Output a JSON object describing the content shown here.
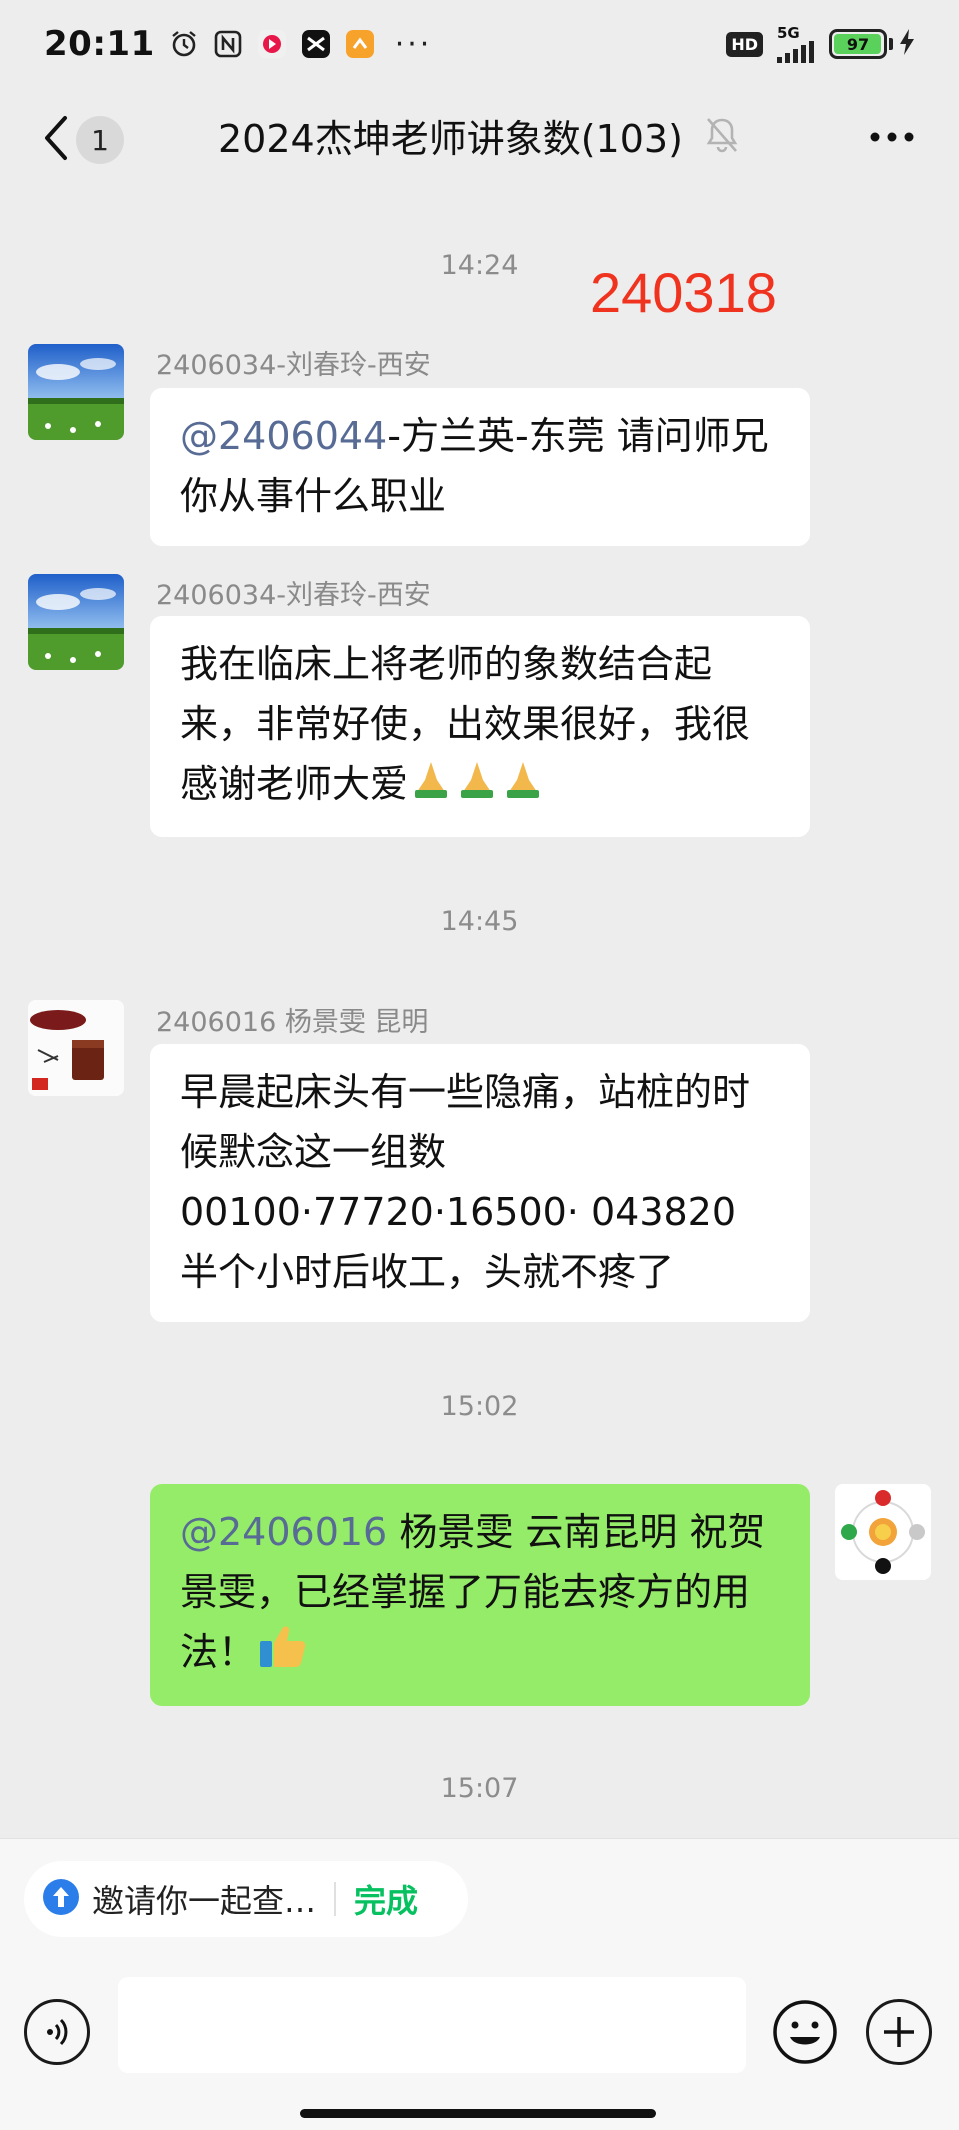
{
  "status_bar": {
    "time": "20:11",
    "network_badge": "HD",
    "network_type": "5G",
    "battery_level": "97",
    "battery_fraction": 0.97,
    "icons": [
      "alarm-icon",
      "nfc-icon",
      "music-app-icon",
      "capcut-icon",
      "orange-app-icon"
    ],
    "more": "···"
  },
  "header": {
    "unread_count": "1",
    "title": "2024杰坤老师讲象数(103)",
    "muted": true
  },
  "chat": {
    "stamp": "240318",
    "time_labels": [
      "14:24",
      "14:45",
      "15:02",
      "15:07"
    ],
    "messages": [
      {
        "sender": "2406034-刘春玲-西安",
        "mention": "@2406044",
        "text": "-方兰英-东莞  请问师兄你从事什么职业"
      },
      {
        "sender": "2406034-刘春玲-西安",
        "text": "我在临床上将老师的象数结合起来，非常好使，出效果很好，我很感谢老师大爱"
      },
      {
        "sender": "2406016  杨景雯  昆明",
        "text": "早晨起床头有一些隐痛，站桩的时候默念这一组数 00100·77720·16500· 043820 半个小时后收工，头就不疼了"
      },
      {
        "mention": "@2406016",
        "text": " 杨景雯  云南昆明  祝贺景雯，已经掌握了万能去疼方的用法！"
      }
    ]
  },
  "bottom": {
    "invite_text": "邀请你一起查…",
    "invite_done": "完成"
  },
  "colors": {
    "background": "#ededed",
    "bubble_received": "#ffffff",
    "bubble_sent": "#95ec69",
    "mention": "#576b95",
    "stamp": "#f0331f",
    "done": "#07c160"
  }
}
